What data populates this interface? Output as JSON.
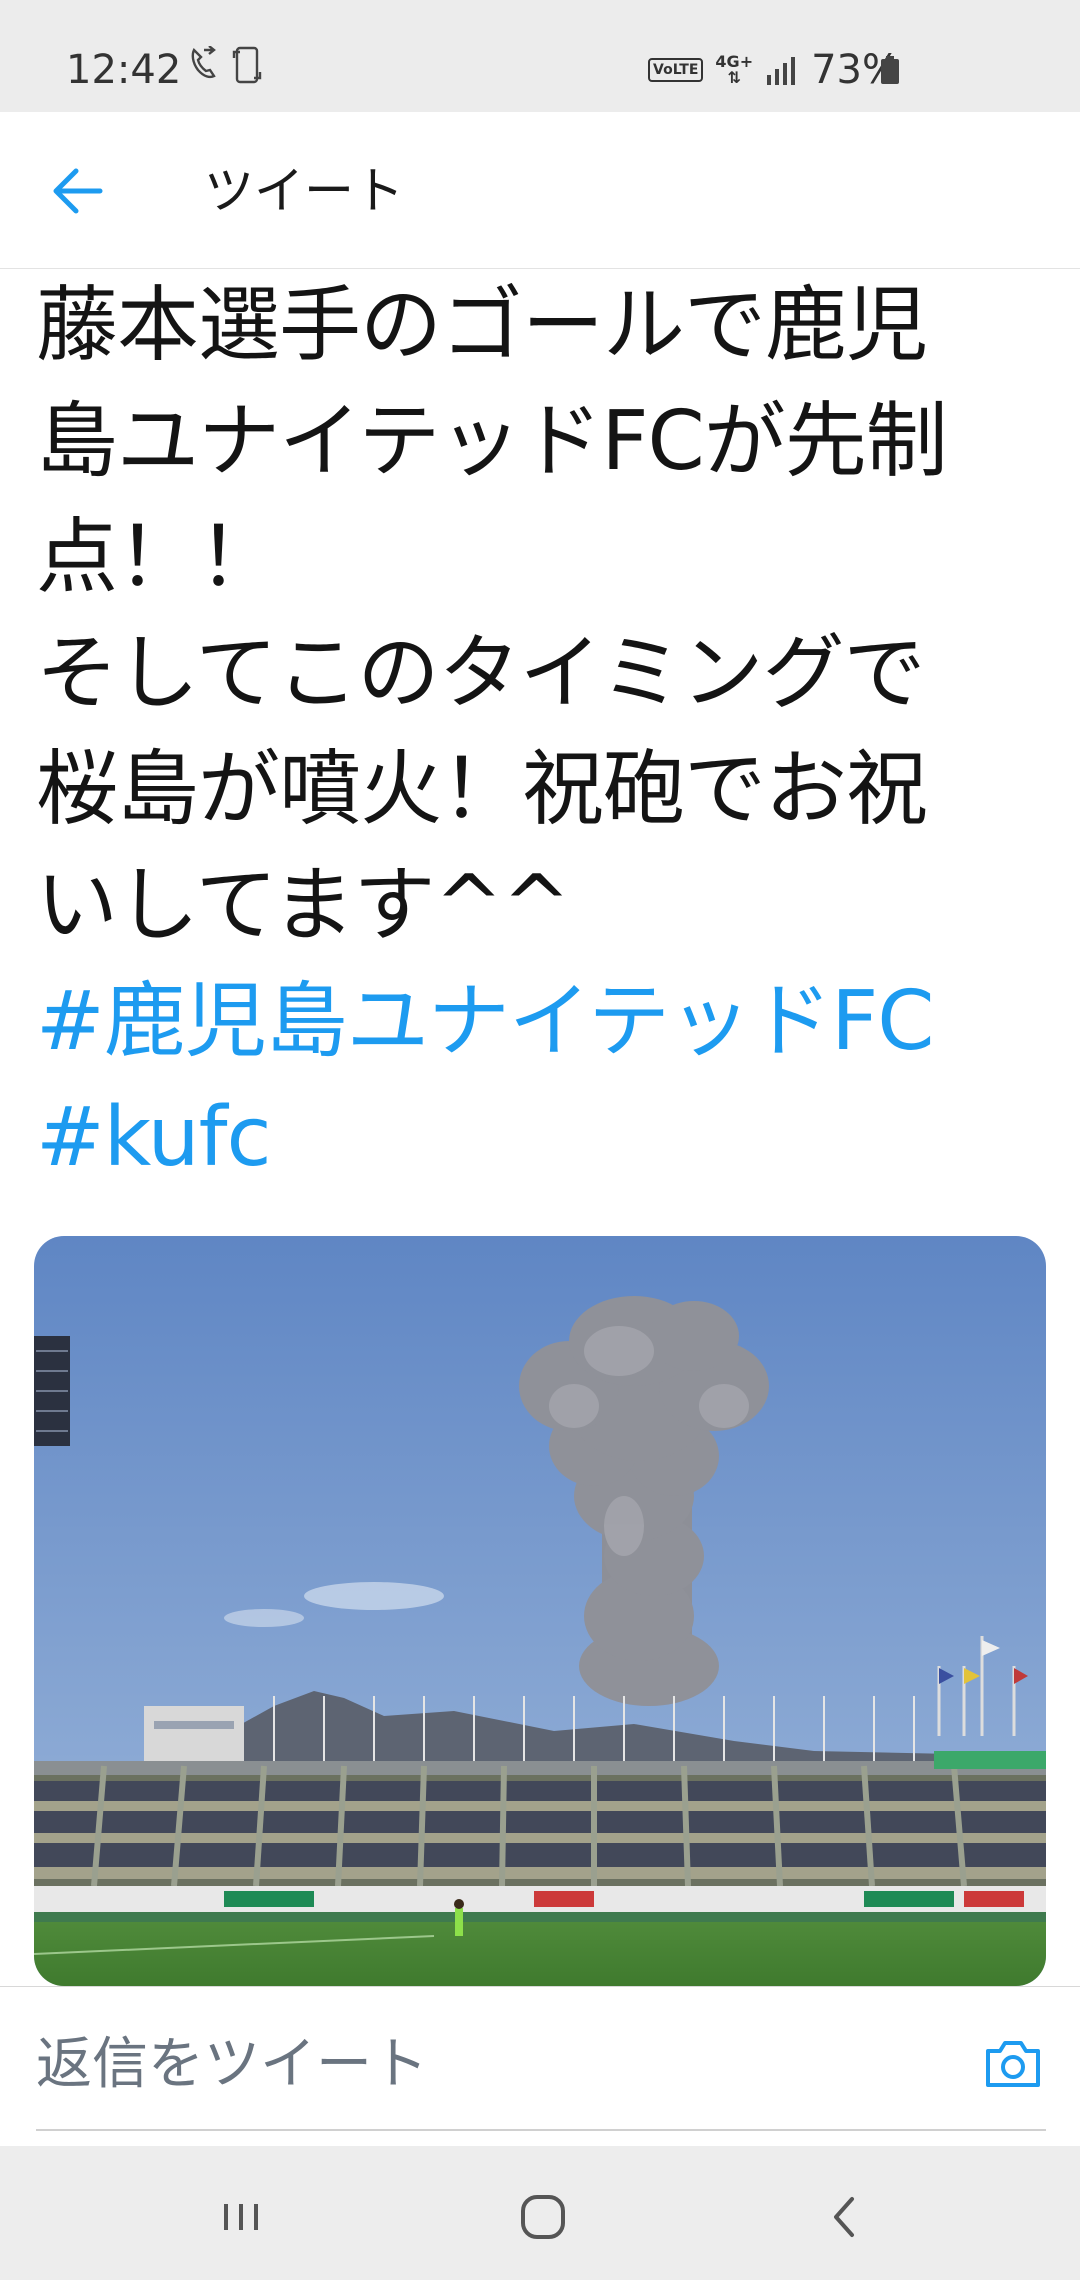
{
  "status_bar": {
    "time": "12:42",
    "volte": "VoLTE",
    "network": "4G+",
    "battery_percent": "73%"
  },
  "header": {
    "title": "ツイート"
  },
  "tweet": {
    "lines": [
      "藤本選手のゴールで鹿児",
      "島ユナイテッドFCが先制",
      "点！！",
      "そしてこのタイミングで",
      "桜島が噴火！祝砲でお祝",
      "いしてます^^"
    ],
    "hashtags": [
      "#鹿児島ユナイテッドFC",
      "#kufc"
    ]
  },
  "reply": {
    "placeholder": "返信をツイート"
  },
  "colors": {
    "accent": "#1d9bf0",
    "status_bar_bg": "#ececec",
    "nav_bar_bg": "#ededed"
  }
}
